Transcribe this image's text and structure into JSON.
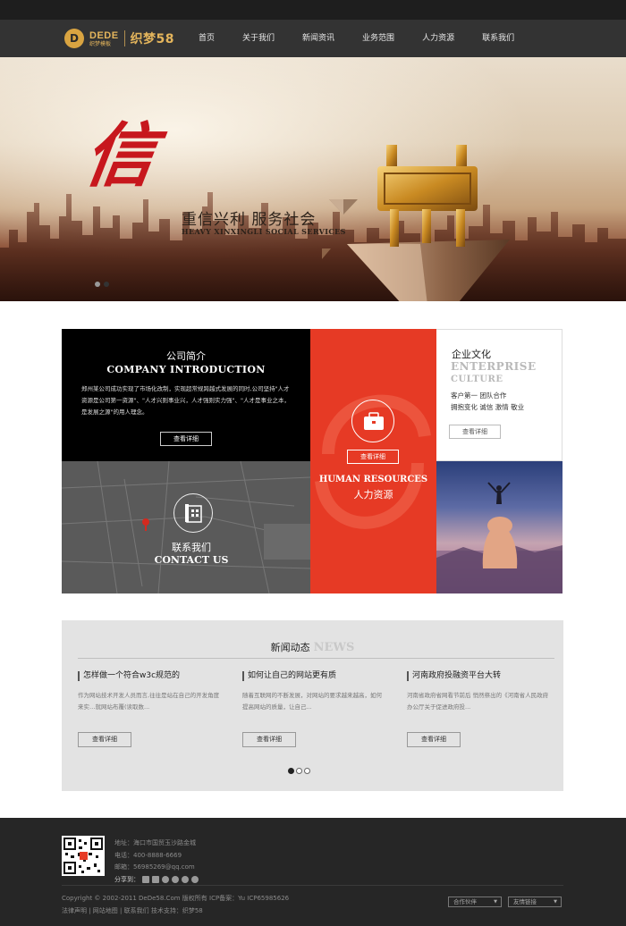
{
  "logo": {
    "mark": "D",
    "en": "DEDE",
    "sub": "织梦模板",
    "cn": "织梦58"
  },
  "nav": [
    "首页",
    "关于我们",
    "新闻资讯",
    "业务范围",
    "人力资源",
    "联系我们"
  ],
  "banner": {
    "big_char": "信",
    "slogan_cn": "重信兴利  服务社会",
    "slogan_en": "HEAVY XINXINGLI SOCIAL SERVICES"
  },
  "intro": {
    "title_cn": "公司简介",
    "title_en": "COMPANY INTRODUCTION",
    "body": "郑州某公司成功实现了市场化改制，实现超常规跨越式发展的同时,公司坚持\"人才资源是公司第一资源\"、\"人才兴则事业兴，人才强则实力强\"、\"人才是事业之本，是发展之源\"的用人理念。",
    "button": "查看详细"
  },
  "contact": {
    "title_cn": "联系我们",
    "title_en": "CONTACT US"
  },
  "hr": {
    "button": "查看详细",
    "title_en": "HUMAN RESOURCES",
    "title_cn": "人力资源"
  },
  "culture": {
    "title_cn": "企业文化",
    "title_en1": "ENTERPRISE",
    "title_en2": "CULTURE",
    "line1": "客户第一    团队合作",
    "line2": "拥抱变化    诚信    激情    敬业",
    "button": "查看详细"
  },
  "news": {
    "title_cn": "新闻动态",
    "title_en": "NEWS",
    "items": [
      {
        "title": "怎样做一个符合w3c规范的",
        "summary": "作为网站技术开发人员而言,往往是站在自己的开发角度来实…就网站布覆(读取数...",
        "button": "查看详细"
      },
      {
        "title": "如何让自己的网站更有质",
        "summary": "随着互联网的不断发展，对网站的要求越来越高，如何提高网站的质量，让自己...",
        "button": "查看详细"
      },
      {
        "title": "河南政府投融资平台大转",
        "summary": "河南省政府省网看节前后 悄然祭出的《河南省人民政府办公厅关于促进政府投...",
        "button": "查看详细"
      }
    ]
  },
  "footer": {
    "address": "地址：海口市国贸玉沙路金城",
    "phone": "电话：400-8888-6669",
    "email": "邮箱：56985269@qq.com",
    "share_label": "分享到：",
    "copyright": "Copyright © 2002-2011 DeDe58.Com 版权所有   ICP备案：Yu ICP65985626",
    "links": "法律声明 | 网站地图 | 联系我们       技术支持：织梦58",
    "select1": "合作伙伴",
    "select2": "友情链接"
  },
  "colors": {
    "header": "#333333",
    "accent_red": "#e63a25",
    "gold": "#e4b55c",
    "footer": "#262626"
  }
}
